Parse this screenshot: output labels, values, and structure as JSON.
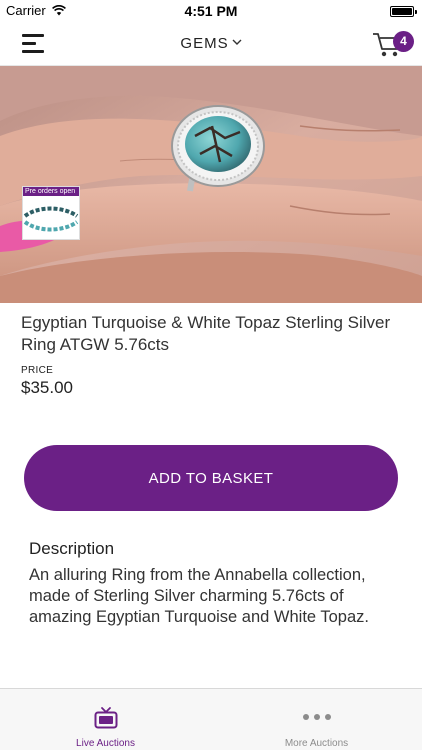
{
  "status_bar": {
    "carrier": "Carrier",
    "time": "4:51 PM"
  },
  "nav": {
    "title": "GEMS",
    "cart_count": "4"
  },
  "hero": {
    "preorder_label": "Pre orders open"
  },
  "product": {
    "title": "Egyptian Turquoise & White Topaz Sterling Silver Ring ATGW 5.76cts",
    "price_label": "PRICE",
    "price": "$35.00"
  },
  "actions": {
    "add_to_basket": "ADD TO BASKET"
  },
  "description": {
    "heading": "Description",
    "text": "An alluring Ring from the Annabella collection, made of Sterling Silver charming 5.76cts of amazing Egyptian Turquoise and White Topaz."
  },
  "tab_bar": {
    "tabs": [
      {
        "label": "Live Auctions",
        "icon": "tv-icon",
        "active": true
      },
      {
        "label": "More Auctions",
        "icon": "more-icon",
        "active": false
      }
    ]
  },
  "colors": {
    "accent": "#6b2086",
    "inactive": "#8c8c8c"
  }
}
